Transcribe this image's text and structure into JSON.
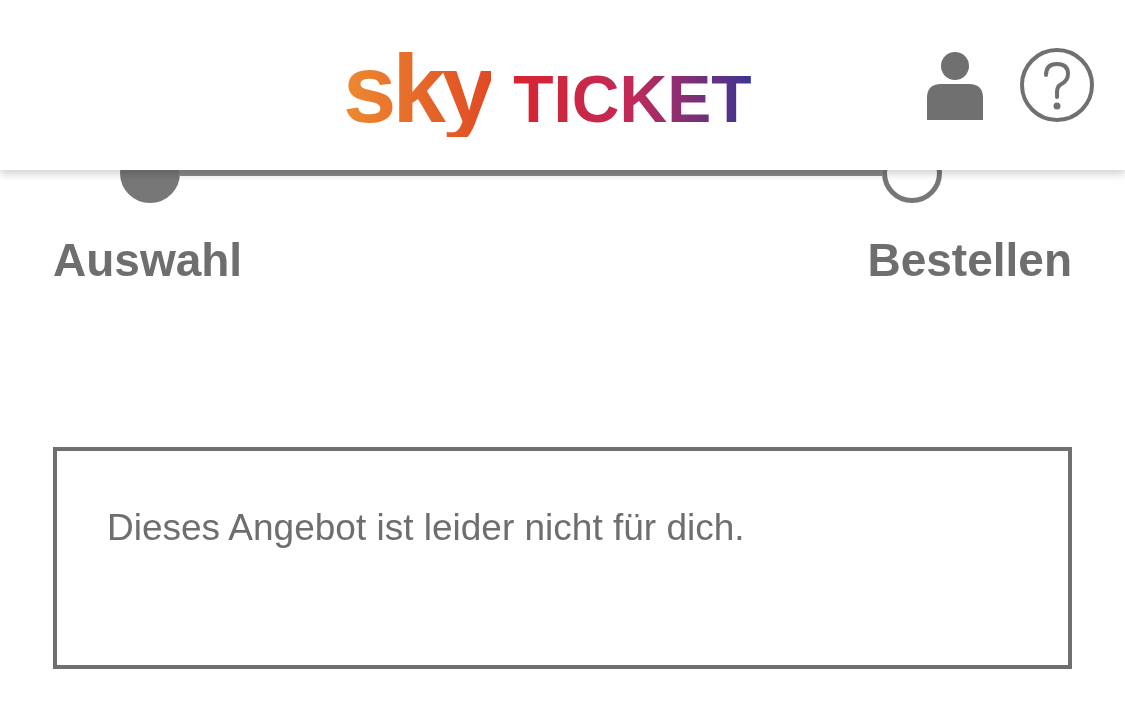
{
  "header": {
    "logo": {
      "brand": "sky",
      "product": "TICKET"
    }
  },
  "steps": [
    {
      "label": "Auswahl",
      "done": true
    },
    {
      "label": "Bestellen",
      "done": false
    }
  ],
  "message": "Dieses Angebot ist leider nicht für dich."
}
